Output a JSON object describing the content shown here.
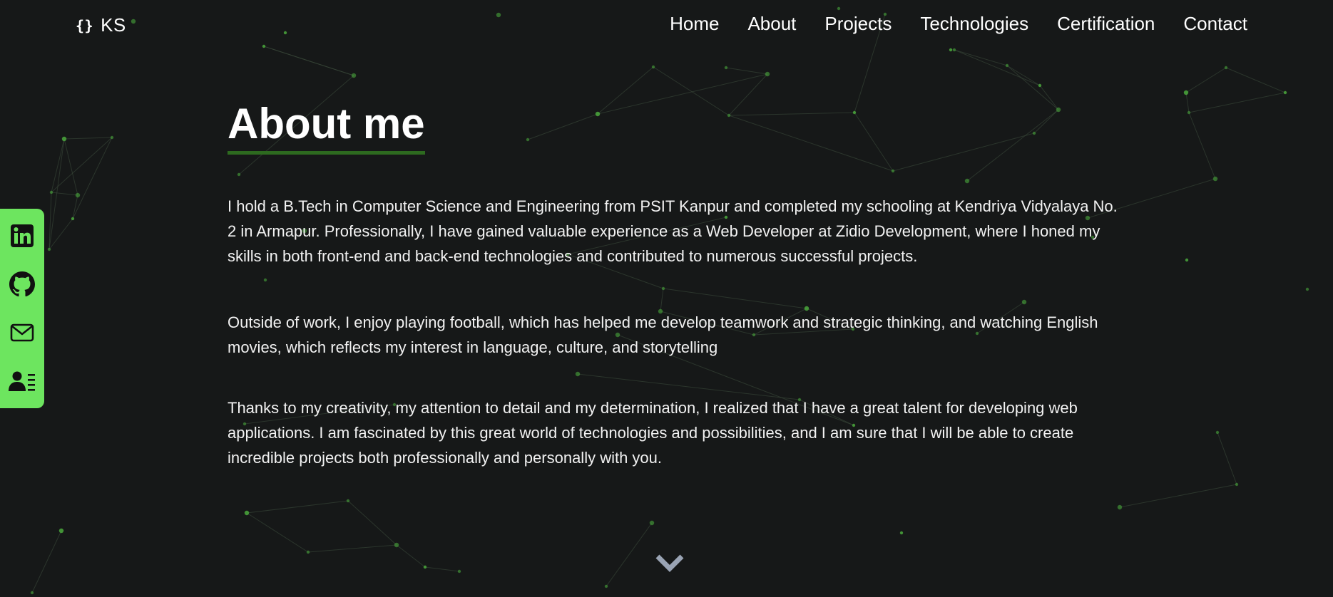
{
  "nav": {
    "logo_icon": "{}",
    "logo_text": "KS",
    "links": [
      {
        "label": "Home"
      },
      {
        "label": "About"
      },
      {
        "label": "Projects"
      },
      {
        "label": "Technologies"
      },
      {
        "label": "Certification"
      },
      {
        "label": "Contact"
      }
    ]
  },
  "about": {
    "title": "About me",
    "paragraphs": [
      "I hold a B.Tech in Computer Science and Engineering from PSIT Kanpur and completed my schooling at Kendriya Vidyalaya No. 2 in Armapur. Professionally, I have gained valuable experience as a Web Developer at Zidio Development, where I honed my skills in both front-end and back-end technologies and contributed to numerous successful projects.",
      "Outside of work, I enjoy playing football, which has helped me develop teamwork and strategic thinking, and watching English movies, which reflects my interest in language, culture, and storytelling",
      "Thanks to my creativity, my attention to detail and my determination, I realized that I have a great talent for developing web applications. I am fascinated by this great world of technologies and possibilities, and I am sure that I will be able to create incredible projects both professionally and personally with you."
    ]
  },
  "social": {
    "items": [
      {
        "icon": "linkedin-icon"
      },
      {
        "icon": "github-icon"
      },
      {
        "icon": "mail-icon"
      },
      {
        "icon": "contact-card-icon"
      }
    ]
  },
  "scroll": {
    "icon": "chevron-down-icon"
  },
  "colors": {
    "background": "#161818",
    "accent": "#6de55f",
    "underline": "#2d6a1f",
    "particle": "#4aa83c",
    "chevron": "#9aa4b4"
  }
}
